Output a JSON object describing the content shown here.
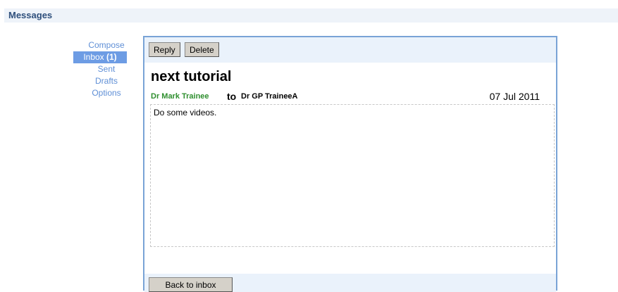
{
  "header": {
    "title": "Messages"
  },
  "sidebar": {
    "items": [
      {
        "label": "Compose"
      },
      {
        "label": "Inbox",
        "count": "(1)",
        "active": true
      },
      {
        "label": "Sent"
      },
      {
        "label": "Drafts"
      },
      {
        "label": "Options"
      }
    ]
  },
  "toolbar": {
    "reply_label": "Reply",
    "delete_label": "Delete"
  },
  "message": {
    "subject": "next tutorial",
    "from": "Dr Mark Trainee",
    "to_word": "to",
    "to": "Dr GP TraineeA",
    "date": "07 Jul 2011",
    "body": "Do some videos."
  },
  "footer": {
    "back_label": "Back to inbox"
  },
  "colors": {
    "accent": "#6d9ce4",
    "link": "#5f8fd6",
    "sender": "#2f8f2f",
    "panel_border": "#79a3d6"
  }
}
